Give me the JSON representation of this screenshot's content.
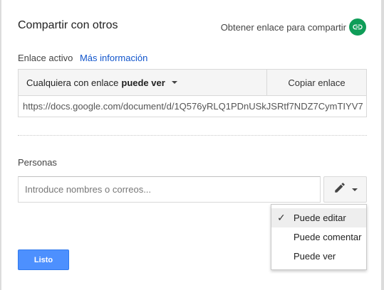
{
  "dialog": {
    "title": "Compartir con otros",
    "get_link_label": "Obtener enlace para compartir",
    "get_link_icon": "link-icon",
    "accent_green": "#0f9d58"
  },
  "link_section": {
    "label": "Enlace activo",
    "more_info": "Más información",
    "permission_prefix": "Cualquiera con enlace",
    "permission_value": "puede ver",
    "copy_label": "Copiar enlace",
    "url": "https://docs.google.com/document/d/1Q576yRLQ1PDnUSkJSRtf7NDZ7CymTIYV7"
  },
  "people": {
    "label": "Personas",
    "input_placeholder": "Introduce nombres o correos...",
    "edit_icon": "pencil-icon"
  },
  "permission_menu": {
    "items": [
      {
        "label": "Puede editar",
        "selected": true
      },
      {
        "label": "Puede comentar",
        "selected": false
      },
      {
        "label": "Puede ver",
        "selected": false
      }
    ]
  },
  "footer": {
    "done_label": "Listo",
    "done_color": "#4d90fe"
  }
}
